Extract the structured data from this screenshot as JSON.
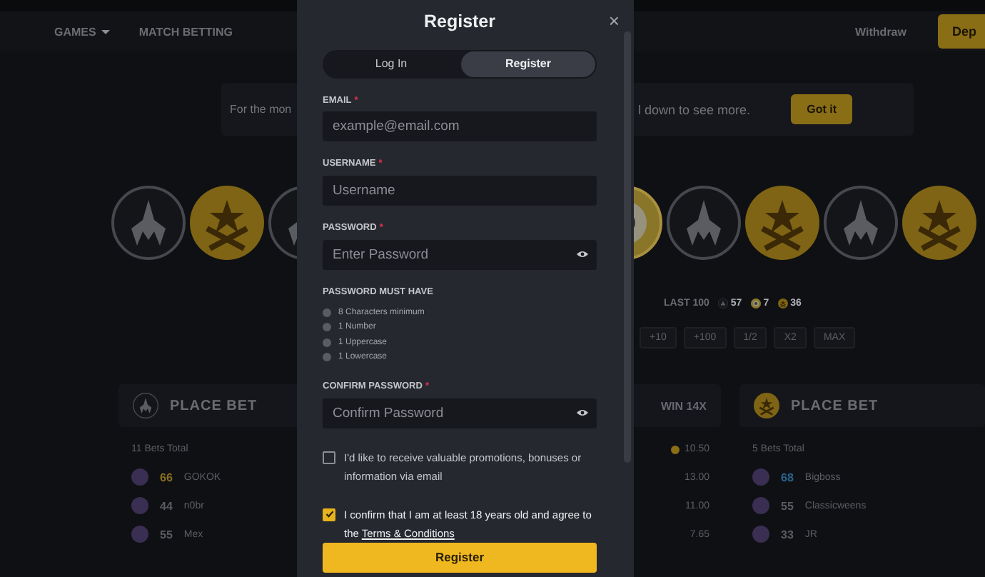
{
  "nav": {
    "items": [
      {
        "label": "GAMES",
        "kind": "dropdown"
      },
      {
        "label": "MATCH BETTING",
        "kind": "link"
      }
    ],
    "withdraw": "Withdraw",
    "deposit": "Dep"
  },
  "notice": {
    "text_start": "For the mon",
    "text_end": "l down to see more.",
    "button": "Got it"
  },
  "history": {
    "left": [
      {
        "kind": "ct"
      },
      {
        "kind": "t"
      },
      {
        "kind": "ct"
      }
    ],
    "right": [
      {
        "kind": "bonus"
      },
      {
        "kind": "ct"
      },
      {
        "kind": "t"
      },
      {
        "kind": "ct"
      },
      {
        "kind": "t"
      }
    ]
  },
  "stats": {
    "label": "LAST 100",
    "counts": [
      {
        "kind": "ct",
        "value": "57"
      },
      {
        "kind": "bonus",
        "value": "7"
      },
      {
        "kind": "t",
        "value": "36"
      }
    ]
  },
  "bet_buttons": [
    "+10",
    "+100",
    "1/2",
    "X2",
    "MAX"
  ],
  "panels": [
    {
      "kind": "ct",
      "title": "PLACE BET",
      "win": "WIN 14X",
      "total": "11 Bets Total",
      "total_amount": "10.50",
      "bets": [
        {
          "level": "66",
          "color": "#8a7020",
          "name": "GOKOK",
          "amount": "13.00"
        },
        {
          "level": "44",
          "color": "#5a5c63",
          "name": "n0br",
          "amount": "11.00"
        },
        {
          "level": "55",
          "color": "#5a5c63",
          "name": "Mex",
          "amount": "7.65"
        }
      ]
    },
    {
      "kind": "t",
      "title": "PLACE BET",
      "total": "5 Bets Total",
      "bets": [
        {
          "level": "68",
          "color": "#2a6590",
          "name": "Bigboss"
        },
        {
          "level": "55",
          "color": "#5a5c63",
          "name": "Classicweens"
        },
        {
          "level": "33",
          "color": "#5a5c63",
          "name": "JR"
        }
      ]
    }
  ],
  "modal": {
    "title": "Register",
    "close": "×",
    "tabs": [
      {
        "label": "Log In",
        "selected": false
      },
      {
        "label": "Register",
        "selected": true
      }
    ],
    "form": [
      {
        "kind": "field",
        "label": "EMAIL",
        "mark": "*",
        "placeholder": "example@email.com",
        "secret": false
      },
      {
        "kind": "field",
        "label": "USERNAME",
        "mark": "*",
        "placeholder": "Username",
        "secret": false
      },
      {
        "kind": "field",
        "label": "PASSWORD",
        "mark": "*",
        "placeholder": "Enter Password",
        "secret": true
      },
      {
        "kind": "rules",
        "title": "PASSWORD MUST HAVE",
        "items": [
          {
            "label": "8 Characters minimum",
            "met": false
          },
          {
            "label": "1 Number",
            "met": false
          },
          {
            "label": "1 Uppercase",
            "met": false
          },
          {
            "label": "1 Lowercase",
            "met": false
          }
        ]
      },
      {
        "kind": "field",
        "label": "CONFIRM PASSWORD",
        "mark": "*",
        "placeholder": "Confirm Password",
        "secret": true
      }
    ],
    "checkboxes": [
      {
        "text": "I'd like to receive valuable promotions, bonuses or information via email",
        "checked": false
      },
      {
        "text": "I confirm that I am at least 18 years old and agree to the",
        "link": "Terms & Conditions",
        "checked": true
      }
    ],
    "submit": "Register"
  }
}
